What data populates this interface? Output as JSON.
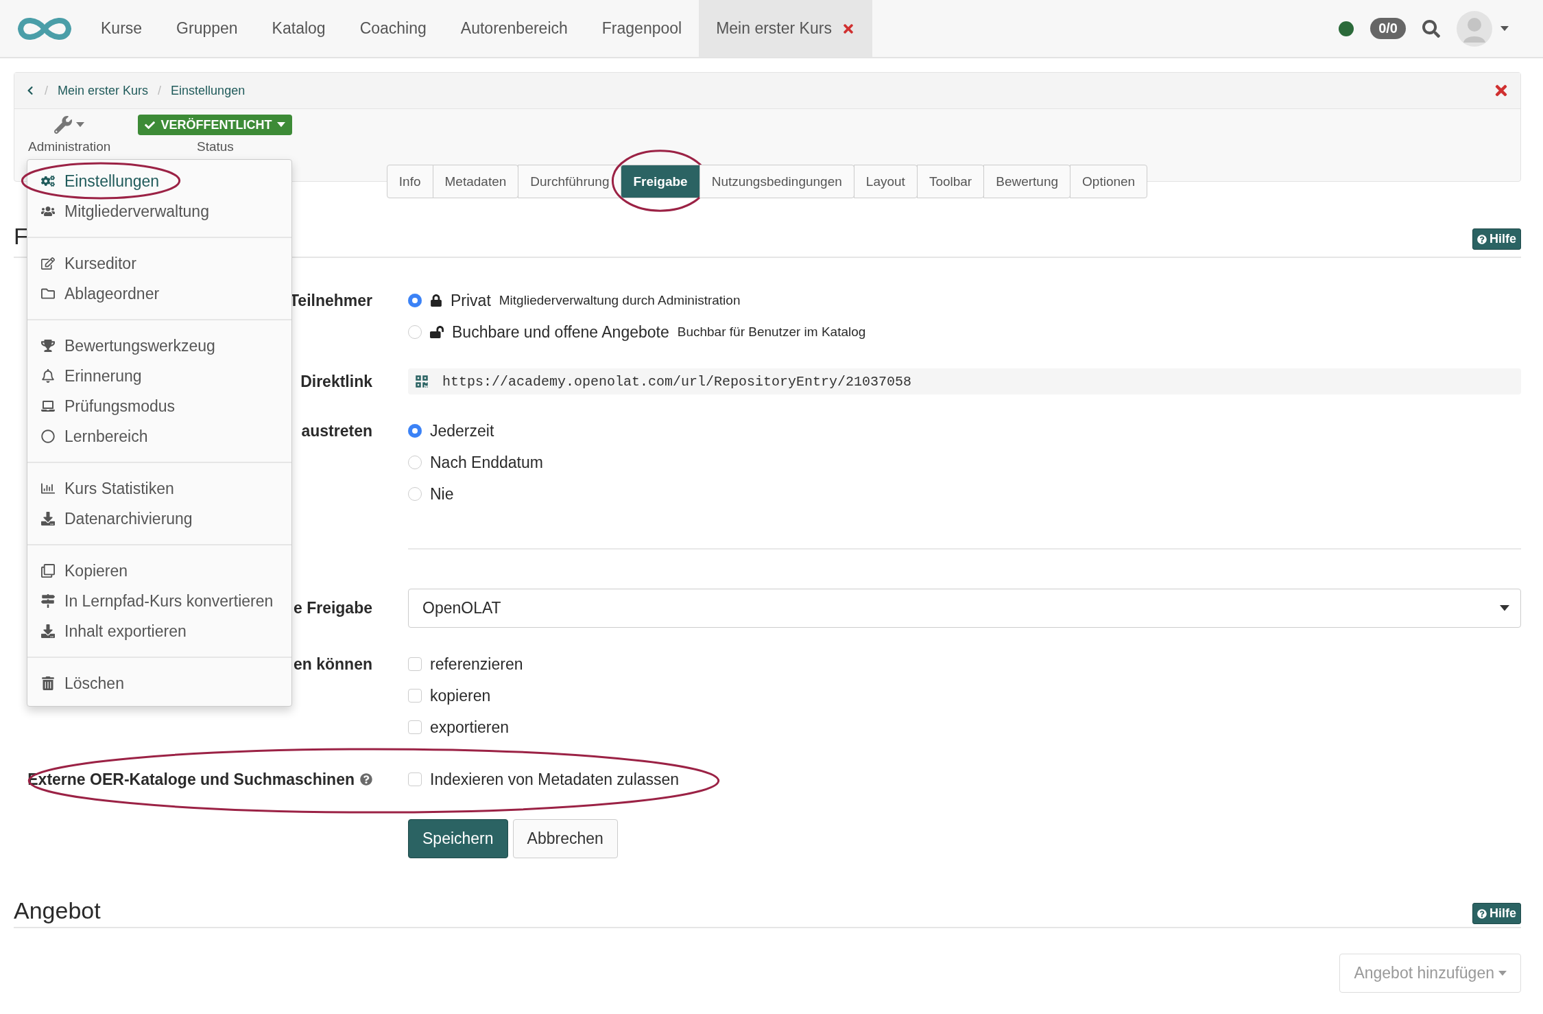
{
  "nav": {
    "items": [
      {
        "label": "Kurse",
        "kind": "link",
        "selected": false
      },
      {
        "label": "Gruppen",
        "kind": "link",
        "selected": false
      },
      {
        "label": "Katalog",
        "kind": "link",
        "selected": false
      },
      {
        "label": "Coaching",
        "kind": "link",
        "selected": false
      },
      {
        "label": "Autorenbereich",
        "kind": "link",
        "selected": false
      },
      {
        "label": "Fragenpool",
        "kind": "link",
        "selected": false
      },
      {
        "label": "Mein erster Kurs",
        "kind": "course",
        "selected": true
      }
    ],
    "online": true,
    "badge": "0/0"
  },
  "breadcrumb": {
    "separator": "/",
    "items": [
      "Mein erster Kurs",
      "Einstellungen"
    ]
  },
  "toolbar": {
    "administration": "Administration",
    "status_label": "Status",
    "status_value": "VERÖFFENTLICHT"
  },
  "admin_menu": {
    "groups": [
      [
        {
          "label": "Einstellungen",
          "selected": true,
          "circled": true
        },
        {
          "label": "Mitgliederverwaltung",
          "selected": false,
          "circled": false
        }
      ],
      [
        {
          "label": "Kurseditor",
          "selected": false,
          "circled": false
        },
        {
          "label": "Ablageordner",
          "selected": false,
          "circled": false
        }
      ],
      [
        {
          "label": "Bewertungswerkzeug",
          "selected": false,
          "circled": false
        },
        {
          "label": "Erinnerung",
          "selected": false,
          "circled": false
        },
        {
          "label": "Prüfungsmodus",
          "selected": false,
          "circled": false
        },
        {
          "label": "Lernbereich",
          "selected": false,
          "circled": false
        }
      ],
      [
        {
          "label": "Kurs Statistiken",
          "selected": false,
          "circled": false
        },
        {
          "label": "Datenarchivierung",
          "selected": false,
          "circled": false
        }
      ],
      [
        {
          "label": "Kopieren",
          "selected": false,
          "circled": false
        },
        {
          "label": "In Lernpfad-Kurs konvertieren",
          "selected": false,
          "circled": false
        },
        {
          "label": "Inhalt exportieren",
          "selected": false,
          "circled": false
        }
      ],
      [
        {
          "label": "Löschen",
          "selected": false,
          "circled": false
        }
      ]
    ]
  },
  "tabs": [
    {
      "label": "Info",
      "selected": false,
      "circled": false
    },
    {
      "label": "Metadaten",
      "selected": false,
      "circled": false
    },
    {
      "label": "Durchführung",
      "selected": false,
      "circled": false
    },
    {
      "label": "Freigabe",
      "selected": true,
      "circled": true
    },
    {
      "label": "Nutzungsbedingungen",
      "selected": false,
      "circled": false
    },
    {
      "label": "Layout",
      "selected": false,
      "circled": false
    },
    {
      "label": "Toolbar",
      "selected": false,
      "circled": false
    },
    {
      "label": "Bewertung",
      "selected": false,
      "circled": false
    },
    {
      "label": "Optionen",
      "selected": false,
      "circled": false
    }
  ],
  "section": {
    "title": "F",
    "help": "Hilfe"
  },
  "form": {
    "rows": [
      {
        "kind": "radio",
        "label": "Teilnehmer",
        "options": [
          {
            "label": "Privat",
            "hint": "Mitgliederverwaltung durch Administration",
            "locked": true,
            "selected": true
          },
          {
            "label": "Buchbare und offene Angebote",
            "hint": "Buchbar für Benutzer im Katalog",
            "locked": false,
            "selected": false
          }
        ]
      },
      {
        "kind": "link",
        "label": "Direktlink",
        "value": "https://academy.openolat.com/url/RepositoryEntry/21037058"
      },
      {
        "kind": "radio",
        "label": "austreten",
        "options": [
          {
            "label": "Jederzeit",
            "selected": true
          },
          {
            "label": "Nach Enddatum",
            "selected": false
          },
          {
            "label": "Nie",
            "selected": false
          }
        ]
      },
      {
        "kind": "divider"
      },
      {
        "kind": "select",
        "label": "e Freigabe",
        "value": "OpenOLAT"
      },
      {
        "kind": "checkbox",
        "label": "en können",
        "options": [
          {
            "label": "referenzieren",
            "checked": false
          },
          {
            "label": "kopieren",
            "checked": false
          },
          {
            "label": "exportieren",
            "checked": false
          }
        ]
      },
      {
        "kind": "checkbox",
        "label": "Externe OER-Kataloge und Suchmaschinen",
        "help": true,
        "circled": true,
        "options": [
          {
            "label": "Indexieren von Metadaten zulassen",
            "checked": false
          }
        ]
      }
    ],
    "buttons": [
      {
        "label": "Speichern",
        "kind": "primary"
      },
      {
        "label": "Abbrechen",
        "kind": "default"
      }
    ]
  },
  "offer_section": {
    "title": "Angebot",
    "help": "Hilfe",
    "add_button": {
      "label": "Angebot hinzufügen",
      "disabled": true
    }
  }
}
